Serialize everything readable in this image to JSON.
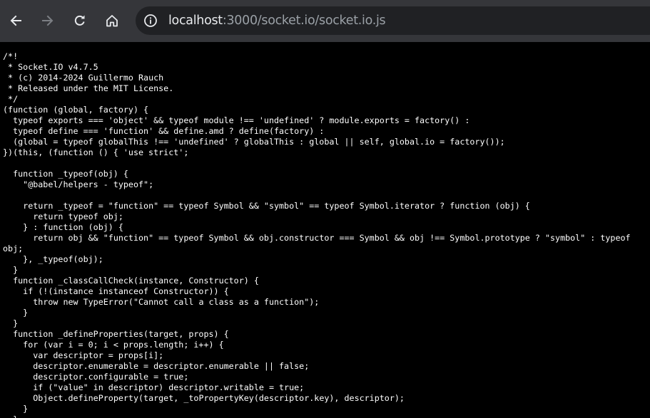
{
  "address_bar": {
    "host": "localhost",
    "path": ":3000/socket.io/socket.io.js"
  },
  "icons": {
    "back": "back-arrow-icon",
    "forward": "forward-arrow-icon",
    "reload": "reload-icon",
    "home": "home-icon",
    "site_info": "site-info-icon"
  },
  "colors": {
    "toolbar": "#35363a",
    "omnibox": "#202124",
    "page_background": "#000000",
    "text": "#ffffff"
  },
  "source_code": "/*!\n * Socket.IO v4.7.5\n * (c) 2014-2024 Guillermo Rauch\n * Released under the MIT License.\n */\n(function (global, factory) {\n  typeof exports === 'object' && typeof module !== 'undefined' ? module.exports = factory() :\n  typeof define === 'function' && define.amd ? define(factory) :\n  (global = typeof globalThis !== 'undefined' ? globalThis : global || self, global.io = factory());\n})(this, (function () { 'use strict';\n\n  function _typeof(obj) {\n    \"@babel/helpers - typeof\";\n\n    return _typeof = \"function\" == typeof Symbol && \"symbol\" == typeof Symbol.iterator ? function (obj) {\n      return typeof obj;\n    } : function (obj) {\n      return obj && \"function\" == typeof Symbol && obj.constructor === Symbol && obj !== Symbol.prototype ? \"symbol\" : typeof obj;\n    }, _typeof(obj);\n  }\n  function _classCallCheck(instance, Constructor) {\n    if (!(instance instanceof Constructor)) {\n      throw new TypeError(\"Cannot call a class as a function\");\n    }\n  }\n  function _defineProperties(target, props) {\n    for (var i = 0; i < props.length; i++) {\n      var descriptor = props[i];\n      descriptor.enumerable = descriptor.enumerable || false;\n      descriptor.configurable = true;\n      if (\"value\" in descriptor) descriptor.writable = true;\n      Object.defineProperty(target, _toPropertyKey(descriptor.key), descriptor);\n    }\n  }"
}
